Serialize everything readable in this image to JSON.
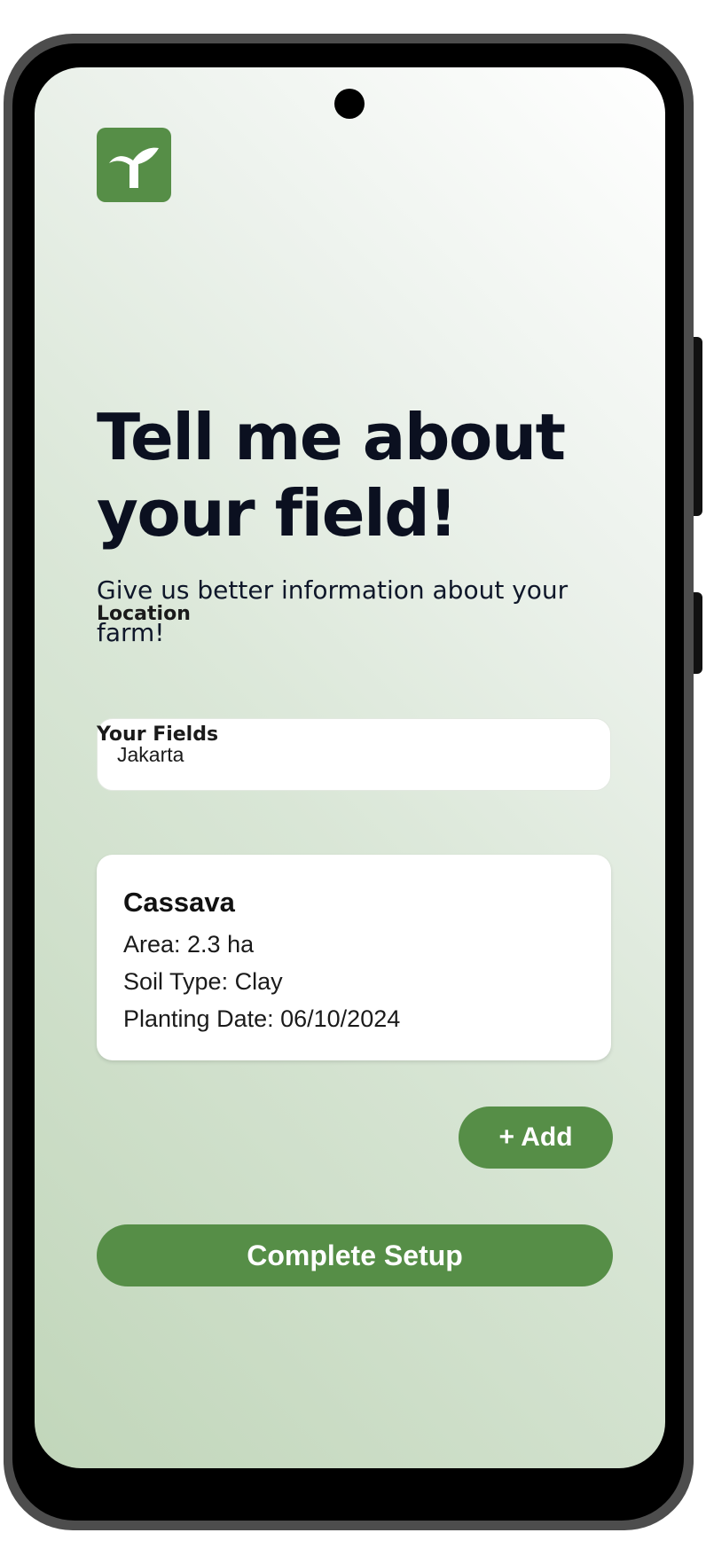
{
  "app": {
    "logo_icon": "sprout-icon",
    "brand_color": "#568e47"
  },
  "header": {
    "title_line1": "Tell me about",
    "title_line2": "your field!",
    "subtitle": "Give us better information about your farm!"
  },
  "location": {
    "label": "Location",
    "value": "Jakarta"
  },
  "fields": {
    "label": "Your Fields",
    "items": [
      {
        "name": "Cassava",
        "area": "Area: 2.3 ha",
        "soil": "Soil Type: Clay",
        "planting_date": "Planting Date: 06/10/2024"
      }
    ]
  },
  "actions": {
    "add_label": "+ Add",
    "complete_label": "Complete Setup"
  }
}
